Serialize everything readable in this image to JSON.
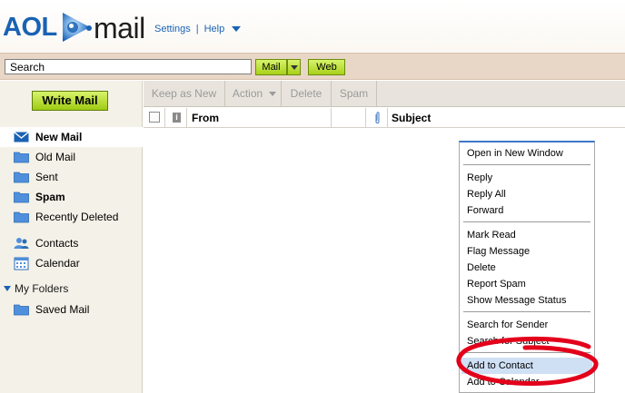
{
  "header": {
    "logo_aol": "AOL",
    "logo_mail": "mail",
    "settings_link": "Settings",
    "separator": "|",
    "help_link": "Help"
  },
  "search": {
    "placeholder": "Search",
    "value": "Search",
    "mail_button": "Mail",
    "web_button": "Web"
  },
  "sidebar": {
    "write_button": "Write Mail",
    "items": [
      {
        "label": "New Mail",
        "icon": "envelope-icon"
      },
      {
        "label": "Old Mail",
        "icon": "folder-icon"
      },
      {
        "label": "Sent",
        "icon": "folder-icon"
      },
      {
        "label": "Spam",
        "icon": "folder-icon"
      },
      {
        "label": "Recently Deleted",
        "icon": "folder-icon"
      },
      {
        "label": "Contacts",
        "icon": "contacts-icon"
      },
      {
        "label": "Calendar",
        "icon": "calendar-icon"
      }
    ],
    "my_folders": "My Folders",
    "folders": [
      {
        "label": "Saved Mail",
        "icon": "folder-icon"
      }
    ]
  },
  "toolbar": {
    "keep_as_new": "Keep as New",
    "action": "Action",
    "delete": "Delete",
    "spam": "Spam"
  },
  "columns": {
    "from": "From",
    "subject": "Subject"
  },
  "context_menu": {
    "items": [
      "Open in New Window",
      "Reply",
      "Reply All",
      "Forward",
      "Mark Read",
      "Flag Message",
      "Delete",
      "Report Spam",
      "Show Message Status",
      "Search for Sender",
      "Search for Subject",
      "Add to Contact",
      "Add to Calendar"
    ]
  },
  "colors": {
    "brand_blue": "#1a62b4",
    "button_green": "#a9d11b",
    "search_bar_bg": "#e8d6c6",
    "sidebar_bg": "#f4f1e8",
    "menu_highlight": "#cfe0f5",
    "annotation_red": "#e3001b"
  }
}
